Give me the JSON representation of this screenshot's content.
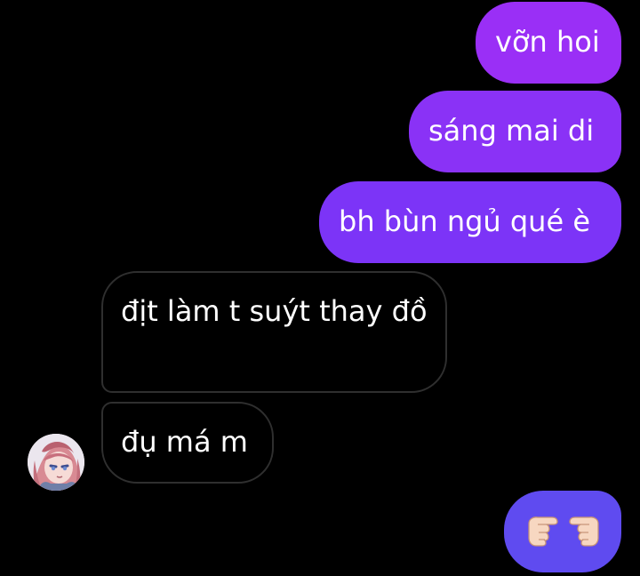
{
  "conversation": {
    "outgoing_color_top": "#9a33f5",
    "outgoing_color_mid": "#7c34f7",
    "outgoing_color_bottom": "#6246ef",
    "incoming_border": "#2f2f2f",
    "messages": [
      {
        "direction": "outgoing",
        "text": "vỡn hoi"
      },
      {
        "direction": "outgoing",
        "text": "sáng mai di"
      },
      {
        "direction": "outgoing",
        "text": "bh bùn ngủ qué è"
      },
      {
        "direction": "incoming",
        "text": "địt làm t suýt thay đồ"
      },
      {
        "direction": "incoming",
        "text": "đụ má m"
      },
      {
        "direction": "outgoing",
        "emoji": "pointing-hands-emoji"
      }
    ]
  },
  "contact": {
    "avatar_icon": "anime-avatar-icon"
  }
}
